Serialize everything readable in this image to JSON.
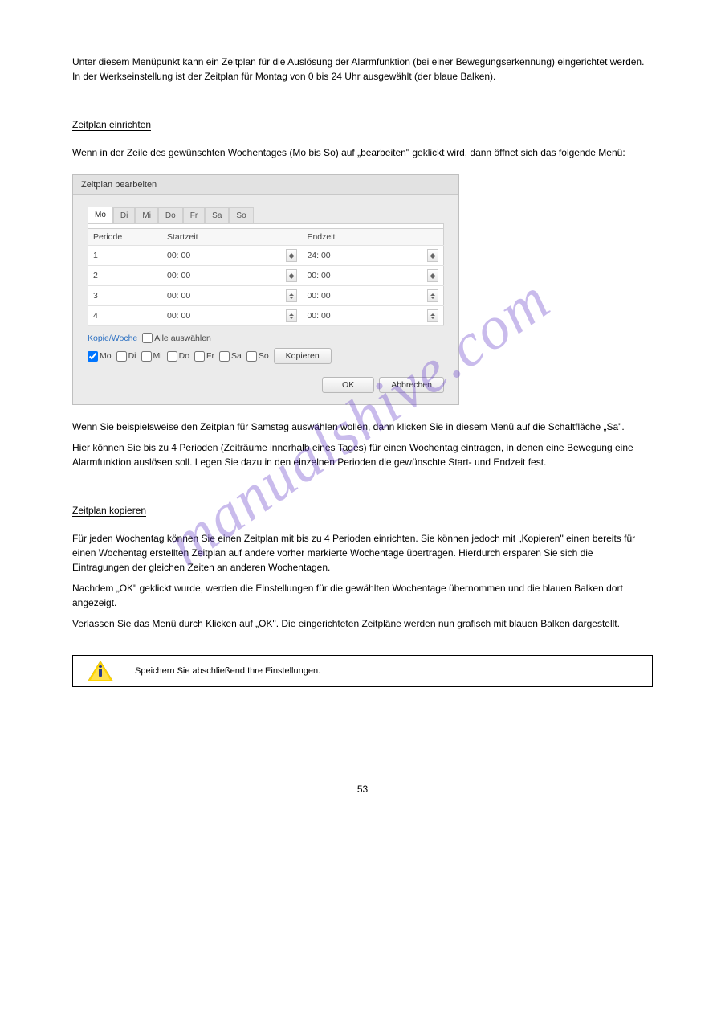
{
  "intro1": "Unter diesem Menüpunkt kann ein Zeitplan für die Auslösung der Alarmfunktion (bei einer Bewegungserkennung) eingerichtet werden. In der Werkseinstellung ist der Zeitplan für Montag von 0 bis 24 Uhr ausgewählt (der blaue Balken).",
  "heading1": "Zeitplan einrichten",
  "para1": "Wenn in der Zeile des gewünschten Wochentages (Mo bis So) auf „bearbeiten\" geklickt wird, dann öffnet sich das folgende Menü:",
  "dialog": {
    "title": "Zeitplan bearbeiten",
    "tabs": [
      "Mo",
      "Di",
      "Mi",
      "Do",
      "Fr",
      "Sa",
      "So"
    ],
    "columns": {
      "periode": "Periode",
      "start": "Startzeit",
      "end": "Endzeit"
    },
    "rows": [
      {
        "idx": "1",
        "start": "00: 00",
        "end": "24: 00"
      },
      {
        "idx": "2",
        "start": "00: 00",
        "end": "00: 00"
      },
      {
        "idx": "3",
        "start": "00: 00",
        "end": "00: 00"
      },
      {
        "idx": "4",
        "start": "00: 00",
        "end": "00: 00"
      }
    ],
    "copy_label": "Kopie/Woche",
    "select_all": "Alle auswählen",
    "days": [
      "Mo",
      "Di",
      "Mi",
      "Do",
      "Fr",
      "Sa",
      "So"
    ],
    "copy_btn": "Kopieren",
    "ok": "OK",
    "cancel": "Abbrechen"
  },
  "para2": "Wenn Sie beispielsweise den Zeitplan für Samstag auswählen wollen, dann klicken Sie in diesem Menü auf die Schaltfläche „Sa\".",
  "para3": "Hier können Sie bis zu 4 Perioden (Zeiträume innerhalb eines Tages) für einen Wochentag eintragen, in denen eine Bewegung eine Alarmfunktion auslösen soll. Legen Sie dazu in den einzelnen Perioden die gewünschte Start- und Endzeit fest.",
  "heading2": "Zeitplan kopieren",
  "para4": "Für jeden Wochentag können Sie einen Zeitplan mit bis zu 4 Perioden einrichten. Sie können jedoch mit „Kopieren\" einen bereits für einen Wochentag erstellten Zeitplan auf andere vorher markierte Wochentage übertragen. Hierdurch ersparen Sie sich die Eintragungen der gleichen Zeiten an anderen Wochentagen.",
  "para5": "Nachdem „OK\" geklickt wurde, werden die Einstellungen für die gewählten Wochentage übernommen und die blauen Balken dort angezeigt.",
  "para6": "Verlassen Sie das Menü durch Klicken auf „OK\". Die eingerichteten Zeitpläne werden nun grafisch mit blauen Balken dargestellt.",
  "note": "Speichern Sie abschließend Ihre Einstellungen.",
  "page_number": "53",
  "watermark": "manualshive.com"
}
